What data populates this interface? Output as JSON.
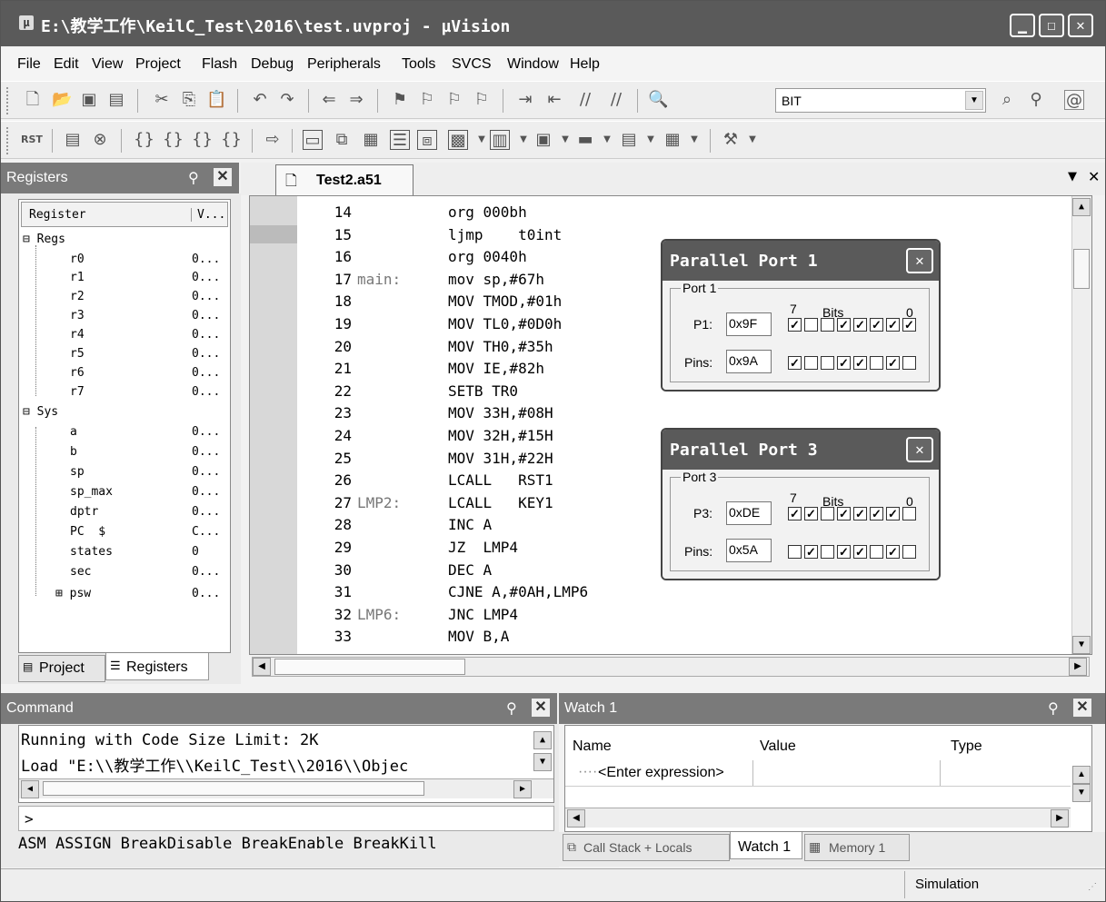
{
  "window": {
    "title": "E:\\教学工作\\KeilC_Test\\2016\\test.uvproj - µVision",
    "icon": "uvision-app-icon"
  },
  "menu": [
    {
      "label": "File"
    },
    {
      "label": "Edit"
    },
    {
      "label": "View"
    },
    {
      "label": "Project"
    },
    {
      "label": "Flash"
    },
    {
      "label": "Debug"
    },
    {
      "label": "Peripherals"
    },
    {
      "label": "Tools"
    },
    {
      "label": "SVCS"
    },
    {
      "label": "Window"
    },
    {
      "label": "Help"
    }
  ],
  "toolbar": {
    "combo_value": "BIT"
  },
  "registers_panel": {
    "title": "Registers",
    "col_register": "Register",
    "col_value": "V...",
    "groups": {
      "regs": "Regs",
      "sys": "Sys"
    },
    "regs": [
      {
        "name": "r0",
        "value": "0..."
      },
      {
        "name": "r1",
        "value": "0..."
      },
      {
        "name": "r2",
        "value": "0..."
      },
      {
        "name": "r3",
        "value": "0..."
      },
      {
        "name": "r4",
        "value": "0..."
      },
      {
        "name": "r5",
        "value": "0..."
      },
      {
        "name": "r6",
        "value": "0..."
      },
      {
        "name": "r7",
        "value": "0..."
      }
    ],
    "sys": [
      {
        "name": "a",
        "value": "0..."
      },
      {
        "name": "b",
        "value": "0..."
      },
      {
        "name": "sp",
        "value": "0..."
      },
      {
        "name": "sp_max",
        "value": "0..."
      },
      {
        "name": "dptr",
        "value": "0..."
      },
      {
        "name": "PC  $",
        "value": "C..."
      },
      {
        "name": "states",
        "value": "0"
      },
      {
        "name": "sec",
        "value": "0..."
      },
      {
        "name": "psw",
        "value": "0..."
      }
    ],
    "tabs": {
      "project": "Project",
      "registers": "Registers"
    }
  },
  "editor": {
    "tab": "Test2.a51",
    "lines": [
      {
        "no": "14",
        "label": "",
        "code": "org 000bh"
      },
      {
        "no": "15",
        "label": "",
        "code": "ljmp    t0int"
      },
      {
        "no": "16",
        "label": "",
        "code": "org 0040h"
      },
      {
        "no": "17",
        "label": "main:",
        "code": "mov sp,#67h"
      },
      {
        "no": "18",
        "label": "",
        "code": "MOV TMOD,#01h"
      },
      {
        "no": "19",
        "label": "",
        "code": "MOV TL0,#0D0h"
      },
      {
        "no": "20",
        "label": "",
        "code": "MOV TH0,#35h"
      },
      {
        "no": "21",
        "label": "",
        "code": "MOV IE,#82h"
      },
      {
        "no": "22",
        "label": "",
        "code": "SETB TR0"
      },
      {
        "no": "23",
        "label": "",
        "code": "MOV 33H,#08H"
      },
      {
        "no": "24",
        "label": "",
        "code": "MOV 32H,#15H"
      },
      {
        "no": "25",
        "label": "",
        "code": "MOV 31H,#22H"
      },
      {
        "no": "26",
        "label": "",
        "code": "LCALL   RST1"
      },
      {
        "no": "27",
        "label": "LMP2:",
        "code": "LCALL   KEY1"
      },
      {
        "no": "28",
        "label": "",
        "code": "INC A"
      },
      {
        "no": "29",
        "label": "",
        "code": "JZ  LMP4"
      },
      {
        "no": "30",
        "label": "",
        "code": "DEC A"
      },
      {
        "no": "31",
        "label": "",
        "code": "CJNE A,#0AH,LMP6"
      },
      {
        "no": "32",
        "label": "LMP6:",
        "code": "JNC LMP4"
      },
      {
        "no": "33",
        "label": "",
        "code": "MOV B,A"
      }
    ]
  },
  "port1": {
    "title": "Parallel Port 1",
    "group": "Port 1",
    "bits_label": "Bits",
    "bit_hi": "7",
    "bit_lo": "0",
    "reg_label": "P1:",
    "reg_value": "0x9F",
    "pins_label": "Pins:",
    "pins_value": "0x9A",
    "reg_bits": [
      1,
      0,
      0,
      1,
      1,
      1,
      1,
      1
    ],
    "pin_bits": [
      1,
      0,
      0,
      1,
      1,
      0,
      1,
      0
    ]
  },
  "port3": {
    "title": "Parallel Port 3",
    "group": "Port 3",
    "bits_label": "Bits",
    "bit_hi": "7",
    "bit_lo": "0",
    "reg_label": "P3:",
    "reg_value": "0xDE",
    "pins_label": "Pins:",
    "pins_value": "0x5A",
    "reg_bits": [
      1,
      1,
      0,
      1,
      1,
      1,
      1,
      0
    ],
    "pin_bits": [
      0,
      1,
      0,
      1,
      1,
      0,
      1,
      0
    ]
  },
  "command": {
    "title": "Command",
    "lines": [
      "Running with Code Size Limit: 2K",
      "Load \"E:\\\\教学工作\\\\KeilC_Test\\\\2016\\\\Objec"
    ],
    "prompt": ">",
    "hint": "ASM ASSIGN BreakDisable BreakEnable BreakKill"
  },
  "watch": {
    "title": "Watch 1",
    "col_name": "Name",
    "col_value": "Value",
    "col_type": "Type",
    "placeholder": "<Enter expression>",
    "tabs": {
      "callstack": "Call Stack + Locals",
      "watch1": "Watch 1",
      "memory1": "Memory 1"
    }
  },
  "status": {
    "mode": "Simulation"
  }
}
